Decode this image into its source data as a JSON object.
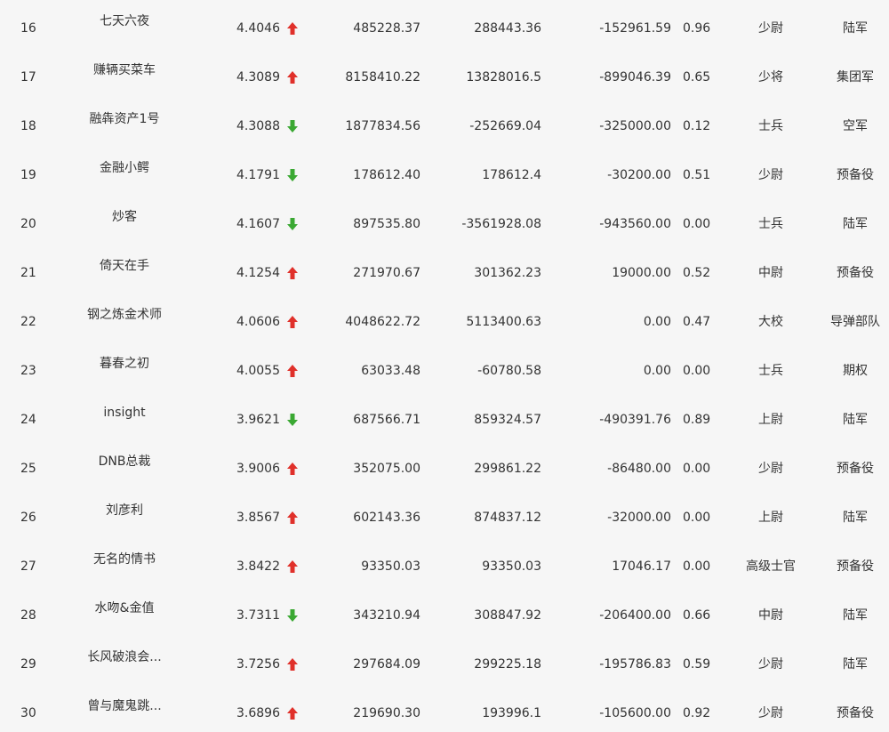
{
  "colors": {
    "up_arrow": "#e0302a",
    "down_arrow": "#3aa832",
    "text": "#333333",
    "background": "#f6f6f6"
  },
  "rows": [
    {
      "rank": "16",
      "name": "七天六夜",
      "score": "4.4046",
      "trend": "up",
      "trend_icon": "red-up-arrow-icon",
      "col1": "485228.37",
      "col2": "288443.36",
      "col3": "-152961.59",
      "col4": "0.96",
      "military_rank": "少尉",
      "branch": "陆军"
    },
    {
      "rank": "17",
      "name": "赚辆买菜车",
      "score": "4.3089",
      "trend": "up",
      "trend_icon": "red-up-arrow-icon",
      "col1": "8158410.22",
      "col2": "13828016.5",
      "col3": "-899046.39",
      "col4": "0.65",
      "military_rank": "少将",
      "branch": "集团军"
    },
    {
      "rank": "18",
      "name": "融犇资产1号",
      "score": "4.3088",
      "trend": "down",
      "trend_icon": "green-down-arrow-icon",
      "col1": "1877834.56",
      "col2": "-252669.04",
      "col3": "-325000.00",
      "col4": "0.12",
      "military_rank": "士兵",
      "branch": "空军"
    },
    {
      "rank": "19",
      "name": "金融小鳄",
      "score": "4.1791",
      "trend": "down",
      "trend_icon": "green-down-arrow-icon",
      "col1": "178612.40",
      "col2": "178612.4",
      "col3": "-30200.00",
      "col4": "0.51",
      "military_rank": "少尉",
      "branch": "预备役"
    },
    {
      "rank": "20",
      "name": "炒客",
      "score": "4.1607",
      "trend": "down",
      "trend_icon": "green-down-arrow-icon",
      "col1": "897535.80",
      "col2": "-3561928.08",
      "col3": "-943560.00",
      "col4": "0.00",
      "military_rank": "士兵",
      "branch": "陆军"
    },
    {
      "rank": "21",
      "name": "倚天在手",
      "score": "4.1254",
      "trend": "up",
      "trend_icon": "red-up-arrow-icon",
      "col1": "271970.67",
      "col2": "301362.23",
      "col3": "19000.00",
      "col4": "0.52",
      "military_rank": "中尉",
      "branch": "预备役"
    },
    {
      "rank": "22",
      "name": "钢之炼金术师",
      "score": "4.0606",
      "trend": "up",
      "trend_icon": "red-up-arrow-icon",
      "col1": "4048622.72",
      "col2": "5113400.63",
      "col3": "0.00",
      "col4": "0.47",
      "military_rank": "大校",
      "branch": "导弹部队"
    },
    {
      "rank": "23",
      "name": "暮春之初",
      "score": "4.0055",
      "trend": "up",
      "trend_icon": "red-up-arrow-icon",
      "col1": "63033.48",
      "col2": "-60780.58",
      "col3": "0.00",
      "col4": "0.00",
      "military_rank": "士兵",
      "branch": "期权"
    },
    {
      "rank": "24",
      "name": "insight",
      "score": "3.9621",
      "trend": "down",
      "trend_icon": "green-down-arrow-icon",
      "col1": "687566.71",
      "col2": "859324.57",
      "col3": "-490391.76",
      "col4": "0.89",
      "military_rank": "上尉",
      "branch": "陆军"
    },
    {
      "rank": "25",
      "name": "DNB总裁",
      "score": "3.9006",
      "trend": "up",
      "trend_icon": "red-up-arrow-icon",
      "col1": "352075.00",
      "col2": "299861.22",
      "col3": "-86480.00",
      "col4": "0.00",
      "military_rank": "少尉",
      "branch": "预备役"
    },
    {
      "rank": "26",
      "name": "刘彦利",
      "score": "3.8567",
      "trend": "up",
      "trend_icon": "red-up-arrow-icon",
      "col1": "602143.36",
      "col2": "874837.12",
      "col3": "-32000.00",
      "col4": "0.00",
      "military_rank": "上尉",
      "branch": "陆军"
    },
    {
      "rank": "27",
      "name": "无名的情书",
      "score": "3.8422",
      "trend": "up",
      "trend_icon": "red-up-arrow-icon",
      "col1": "93350.03",
      "col2": "93350.03",
      "col3": "17046.17",
      "col4": "0.00",
      "military_rank": "高级士官",
      "branch": "预备役"
    },
    {
      "rank": "28",
      "name": "水吻&金值",
      "score": "3.7311",
      "trend": "down",
      "trend_icon": "green-down-arrow-icon",
      "col1": "343210.94",
      "col2": "308847.92",
      "col3": "-206400.00",
      "col4": "0.66",
      "military_rank": "中尉",
      "branch": "陆军"
    },
    {
      "rank": "29",
      "name": "长风破浪会...",
      "score": "3.7256",
      "trend": "up",
      "trend_icon": "red-up-arrow-icon",
      "col1": "297684.09",
      "col2": "299225.18",
      "col3": "-195786.83",
      "col4": "0.59",
      "military_rank": "少尉",
      "branch": "陆军"
    },
    {
      "rank": "30",
      "name": "曾与魔鬼跳...",
      "score": "3.6896",
      "trend": "up",
      "trend_icon": "red-up-arrow-icon",
      "col1": "219690.30",
      "col2": "193996.1",
      "col3": "-105600.00",
      "col4": "0.92",
      "military_rank": "少尉",
      "branch": "预备役"
    }
  ]
}
